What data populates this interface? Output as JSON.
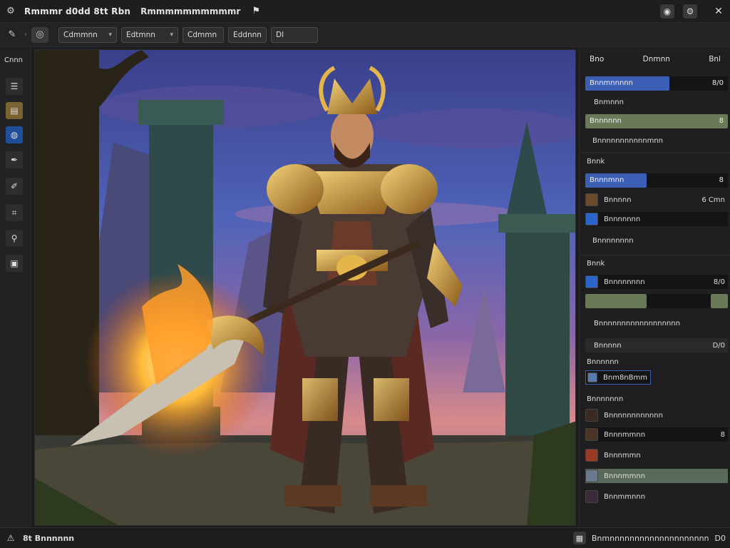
{
  "titlebar": {
    "title": "Rmmmr d0dd 8tt Rbn",
    "subtitle": "Rmmmmmmmmmmr",
    "app_icon": "gear-icon",
    "mini_icon": "flag-icon"
  },
  "toolbar": {
    "select_1": "Cdmmnn",
    "select_2": "Edtmnn",
    "select_3": "Cdmmn",
    "select_4": "Eddnnn",
    "select_5": "Dl"
  },
  "leftbar": {
    "header": "Cnnn"
  },
  "panel": {
    "tabs": [
      "Bno",
      "Dnmnn",
      "Bnl"
    ],
    "layer_name": "Bnnmnnnnn",
    "layer_value": "8/0",
    "row_1": "Bnmnnn",
    "row_2_label": "Bnnnnnn",
    "row_2_value": "8",
    "row_3": "Bnnnnnnnnnnnmnn",
    "section_1": "Bnnk",
    "slider_1": "Bnnnmnn",
    "slider_1_value": "8",
    "swatch_1_label": "Bnnnnn",
    "swatch_1_value": "6 Cmn",
    "swatch_2_label": "Bnnnnnnn",
    "row_4": "Bnnnnnnnn",
    "section_2": "Bnnk",
    "slider_2_label": "Bnnnnnnnn",
    "slider_2_value": "8/0",
    "row_5": "Bnnnnnnnnnnnnnnnnnn",
    "field_1_label": "Bnnnnn",
    "field_1_value": "D/0",
    "section_3": "Bnnnnnn",
    "field_2": "Bnm8nBmm",
    "section_4": "Bnnnnnnn",
    "list": [
      {
        "label": "Bnnnnnnnnnnnn",
        "color": "#3a2a22"
      },
      {
        "label": "Bnnnmmnn",
        "color": "#4a3626",
        "value": "8"
      },
      {
        "label": "Bnnnmmn",
        "color": "#9b3a22"
      },
      {
        "label": "Bnnnmmnn",
        "color": "#6a7a8a"
      },
      {
        "label": "Bnnmmnnn",
        "color": "#3a2a3a"
      }
    ]
  },
  "status": {
    "left_text": "8t Bnnnnnn",
    "right_text": "Bnmnnnnnnnnnnnnnnnnnnnn",
    "right_value": "D0"
  }
}
